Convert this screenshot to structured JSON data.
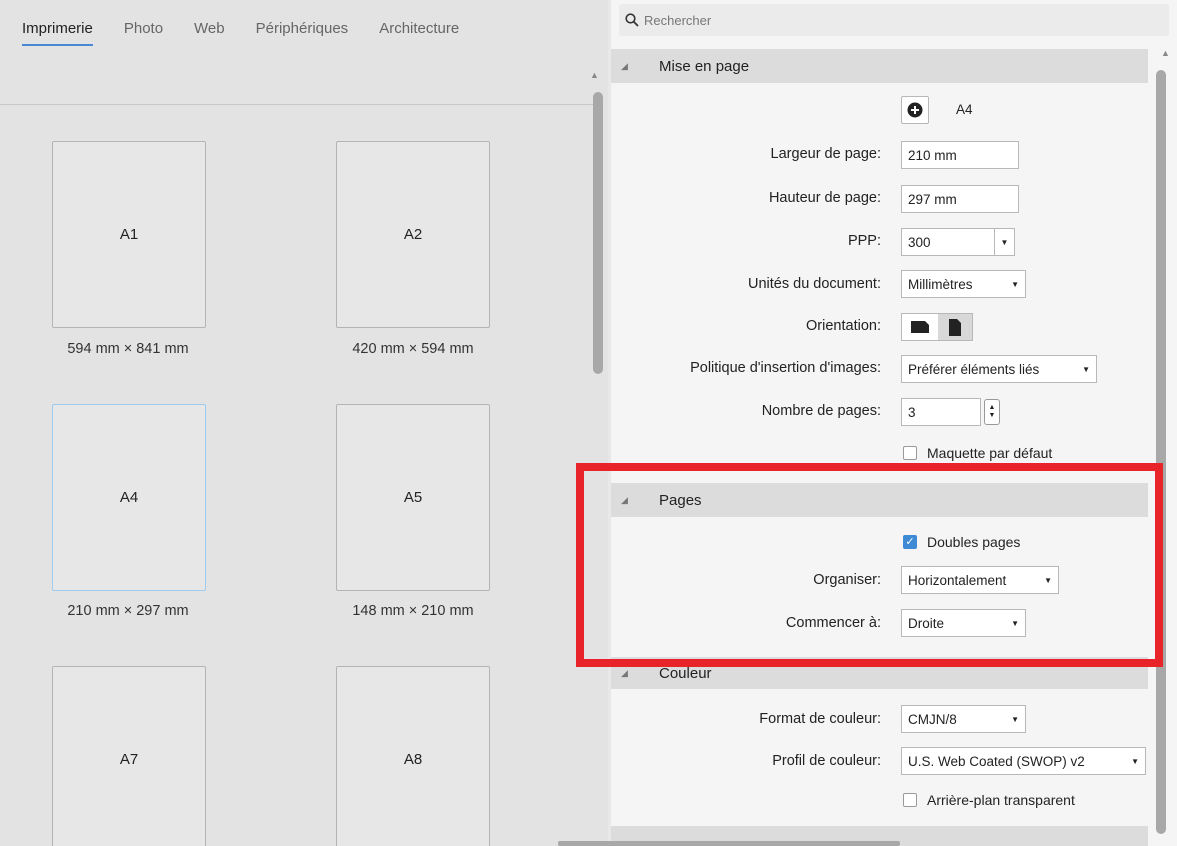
{
  "tabs": [
    {
      "label": "Imprimerie",
      "active": true
    },
    {
      "label": "Photo"
    },
    {
      "label": "Web"
    },
    {
      "label": "Périphériques"
    },
    {
      "label": "Architecture"
    }
  ],
  "presets": [
    {
      "name": "A1",
      "size": "594 mm × 841 mm"
    },
    {
      "name": "A2",
      "size": "420 mm × 594 mm"
    },
    {
      "name": "A4",
      "size": "210 mm × 297 mm",
      "selected": true
    },
    {
      "name": "A5",
      "size": "148 mm × 210 mm"
    },
    {
      "name": "A7",
      "size": ""
    },
    {
      "name": "A8",
      "size": ""
    }
  ],
  "search": {
    "placeholder": "Rechercher"
  },
  "layout": {
    "title": "Mise en page",
    "preset_name": "A4",
    "width_label": "Largeur de page:",
    "width_value": "210 mm",
    "height_label": "Hauteur de page:",
    "height_value": "297 mm",
    "dpi_label": "PPP:",
    "dpi_value": "300",
    "units_label": "Unités du document:",
    "units_value": "Millimètres",
    "orientation_label": "Orientation:",
    "image_policy_label": "Politique d'insertion d'images:",
    "image_policy_value": "Préférer éléments liés",
    "page_count_label": "Nombre de pages:",
    "page_count_value": "3",
    "default_master_label": "Maquette par défaut"
  },
  "pages": {
    "title": "Pages",
    "facing_label": "Doubles pages",
    "arrange_label": "Organiser:",
    "arrange_value": "Horizontalement",
    "start_label": "Commencer à:",
    "start_value": "Droite"
  },
  "color": {
    "title": "Couleur",
    "format_label": "Format de couleur:",
    "format_value": "CMJN/8",
    "profile_label": "Profil de couleur:",
    "profile_value": "U.S. Web Coated (SWOP) v2",
    "transparent_label": "Arrière-plan transparent"
  },
  "colors": {
    "accent": "#4a88d4",
    "highlight": "#e8232a"
  }
}
